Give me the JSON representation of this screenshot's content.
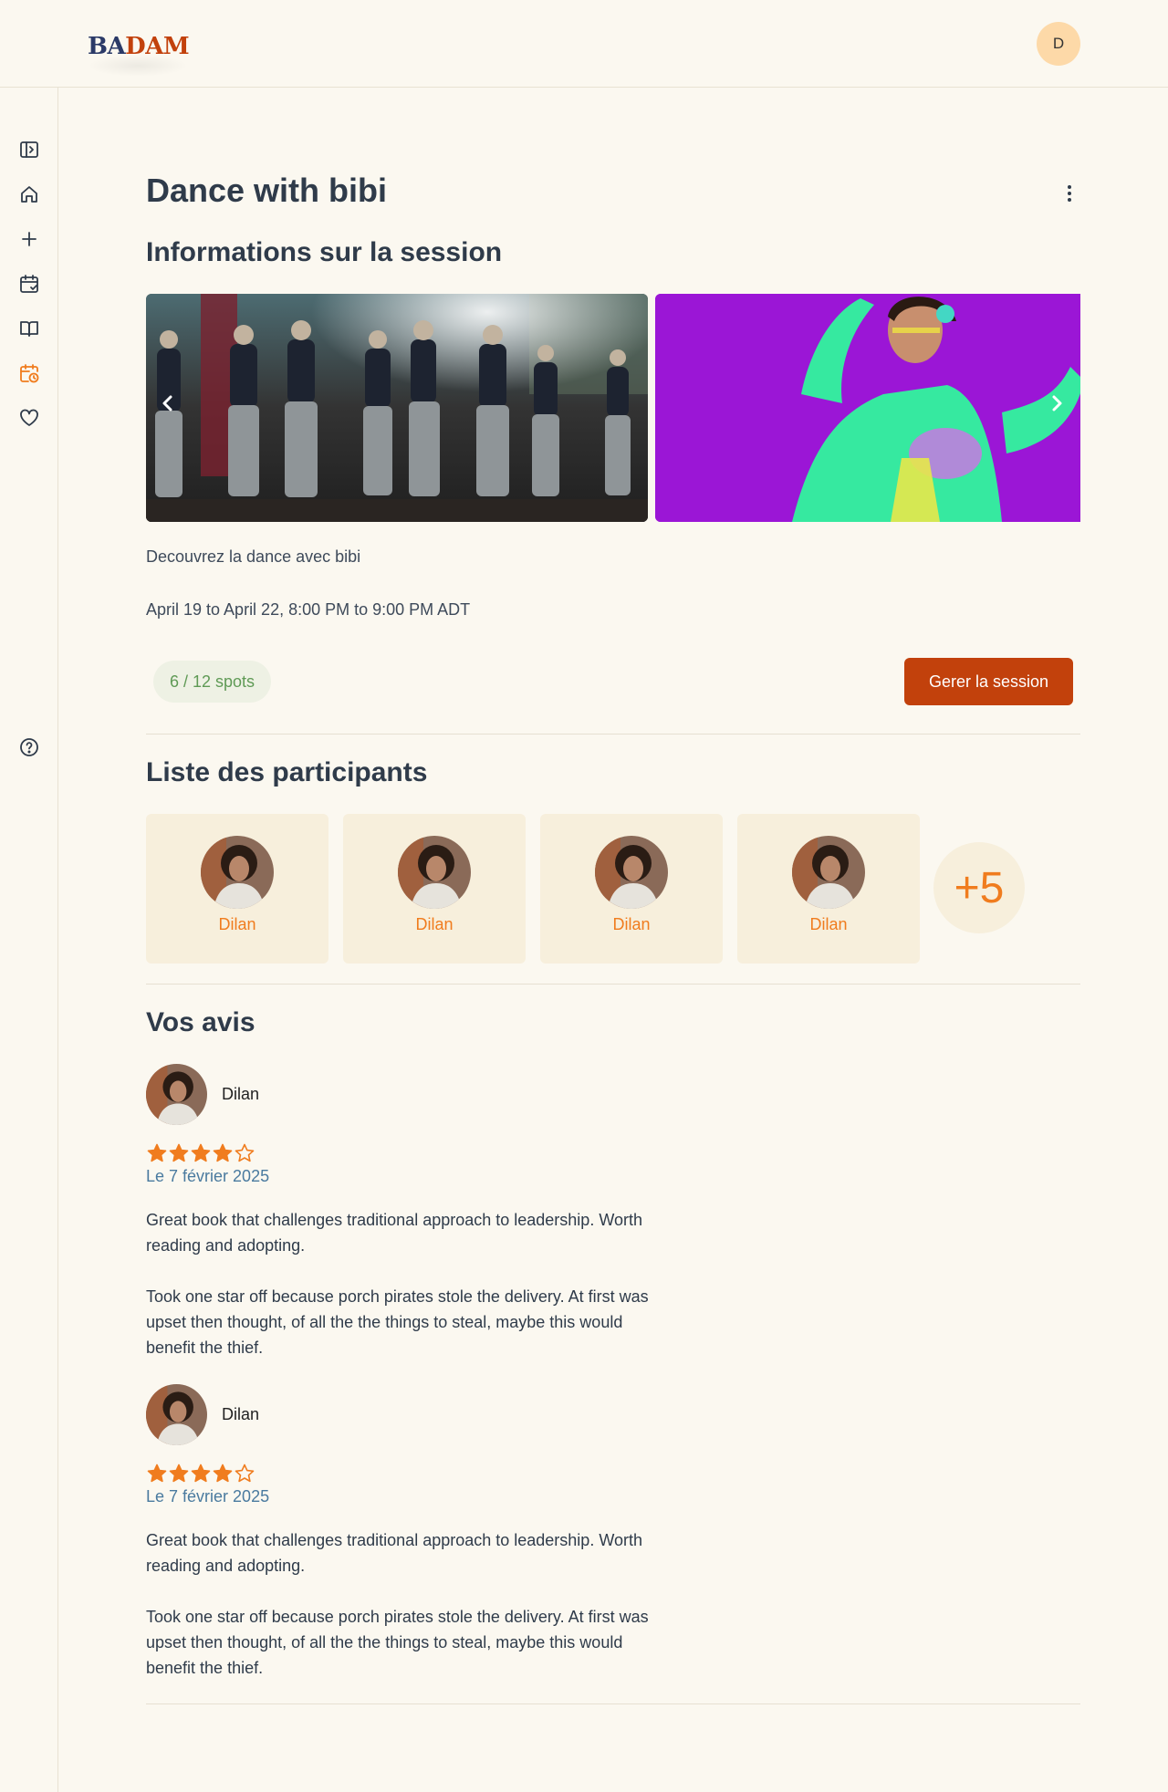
{
  "header": {
    "logo_part1": "BA",
    "logo_part2": "DAM",
    "user_initial": "D"
  },
  "sidebar": {
    "items": [
      {
        "icon": "sidebar-toggle-icon"
      },
      {
        "icon": "home-icon"
      },
      {
        "icon": "plus-icon"
      },
      {
        "icon": "calendar-check-icon"
      },
      {
        "icon": "book-icon"
      },
      {
        "icon": "calendar-clock-icon",
        "active": true
      },
      {
        "icon": "heart-icon"
      },
      {
        "icon": "help-circle-icon"
      }
    ],
    "active_color": "#f07c1e"
  },
  "session": {
    "title": "Dance with bibi",
    "info_heading": "Informations sur la session",
    "description": "Decouvrez la dance avec bibi",
    "dates": "April 19 to April 22, 8:00 PM to 9:00 PM ADT",
    "spots": "6 / 12 spots",
    "manage_label": "Gerer la session"
  },
  "participants": {
    "heading": "Liste des participants",
    "items": [
      {
        "name": "Dilan"
      },
      {
        "name": "Dilan"
      },
      {
        "name": "Dilan"
      },
      {
        "name": "Dilan"
      }
    ],
    "more_label": "+5"
  },
  "reviews": {
    "heading": "Vos avis",
    "items": [
      {
        "name": "Dilan",
        "rating": 4,
        "max_rating": 5,
        "date": "Le 7 février 2025",
        "paragraph1": "Great book that challenges traditional approach to leadership. Worth reading and adopting.",
        "paragraph2": "Took one star off because porch pirates stole the delivery. At first was upset then thought, of all the the things to steal, maybe this would benefit the thief."
      },
      {
        "name": "Dilan",
        "rating": 4,
        "max_rating": 5,
        "date": "Le 7 février 2025",
        "paragraph1": "Great book that challenges traditional approach to leadership. Worth reading and adopting.",
        "paragraph2": "Took one star off because porch pirates stole the delivery. At first was upset then thought, of all the the things to steal, maybe this would benefit the thief."
      }
    ]
  },
  "colors": {
    "accent": "#c2410c",
    "orange": "#f07c1e",
    "background": "#fbf8f0"
  }
}
